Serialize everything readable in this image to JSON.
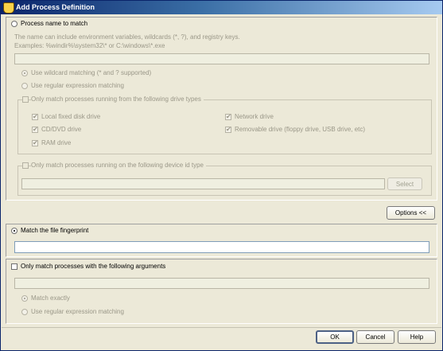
{
  "window": {
    "title": "Add Process Definition",
    "close_symbol": "×"
  },
  "process_name": {
    "radio_label": "Process name to match",
    "help_line1": "The name can include environment variables, wildcards (*, ?), and registry keys.",
    "help_line2": "Examples: %windir%\\system32\\* or C:\\windows\\*.exe",
    "input_value": "",
    "match_wildcard_label": "Use wildcard matching (* and ? supported)",
    "match_regex_label": "Use regular expression matching",
    "drive_types": {
      "checkbox_label": "Only match processes running from the following drive types",
      "local_fixed": "Local fixed disk drive",
      "cd_dvd": "CD/DVD drive",
      "ram": "RAM drive",
      "network": "Network drive",
      "removable": "Removable drive (floppy drive, USB drive, etc)"
    },
    "device_id": {
      "checkbox_label": "Only match processes running on the following device id type",
      "input_value": "",
      "select_label": "Select"
    }
  },
  "options_button": "Options <<",
  "fingerprint": {
    "radio_label": "Match the file fingerprint",
    "input_value": ""
  },
  "arguments": {
    "checkbox_label": "Only match processes with the following arguments",
    "input_value": "",
    "match_exactly_label": "Match exactly",
    "match_regex_label": "Use regular expression matching"
  },
  "footer": {
    "ok": "OK",
    "cancel": "Cancel",
    "help": "Help"
  },
  "check_mark": "✔"
}
